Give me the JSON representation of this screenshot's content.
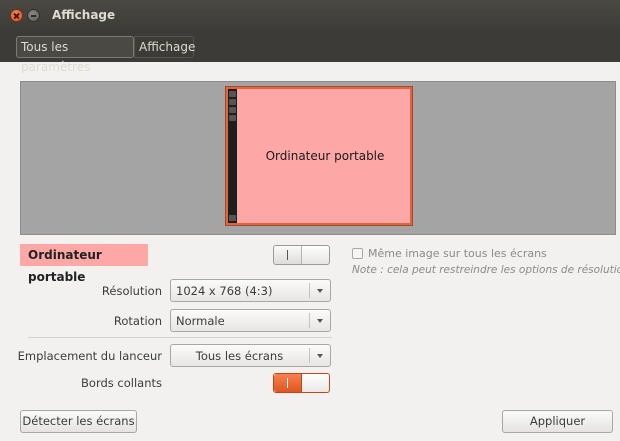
{
  "window": {
    "title": "Affichage"
  },
  "breadcrumbs": [
    "Tous les paramètres",
    "Affichage"
  ],
  "preview": {
    "monitor_label": "Ordinateur portable"
  },
  "display": {
    "name": "Ordinateur portable",
    "enabled_switch_on": false,
    "mirror_label": "Même image sur tous les écrans",
    "mirror_checked": false,
    "note": "Note : cela peut restreindre les options de résolution",
    "resolution_label": "Résolution",
    "resolution_value": "1024 x 768 (4:3)",
    "rotation_label": "Rotation",
    "rotation_value": "Normale"
  },
  "launcher": {
    "placement_label": "Emplacement du lanceur",
    "placement_value": "Tous les écrans",
    "sticky_label": "Bords collants",
    "sticky_on": true
  },
  "buttons": {
    "detect": "Détecter les écrans",
    "apply": "Appliquer"
  },
  "colors": {
    "accent": "#e0551f",
    "monitor_fill": "#fea7a7",
    "titlebar": "#3c3b37"
  },
  "icons": [
    "close-icon",
    "minimize-icon",
    "chevron-down-icon"
  ]
}
